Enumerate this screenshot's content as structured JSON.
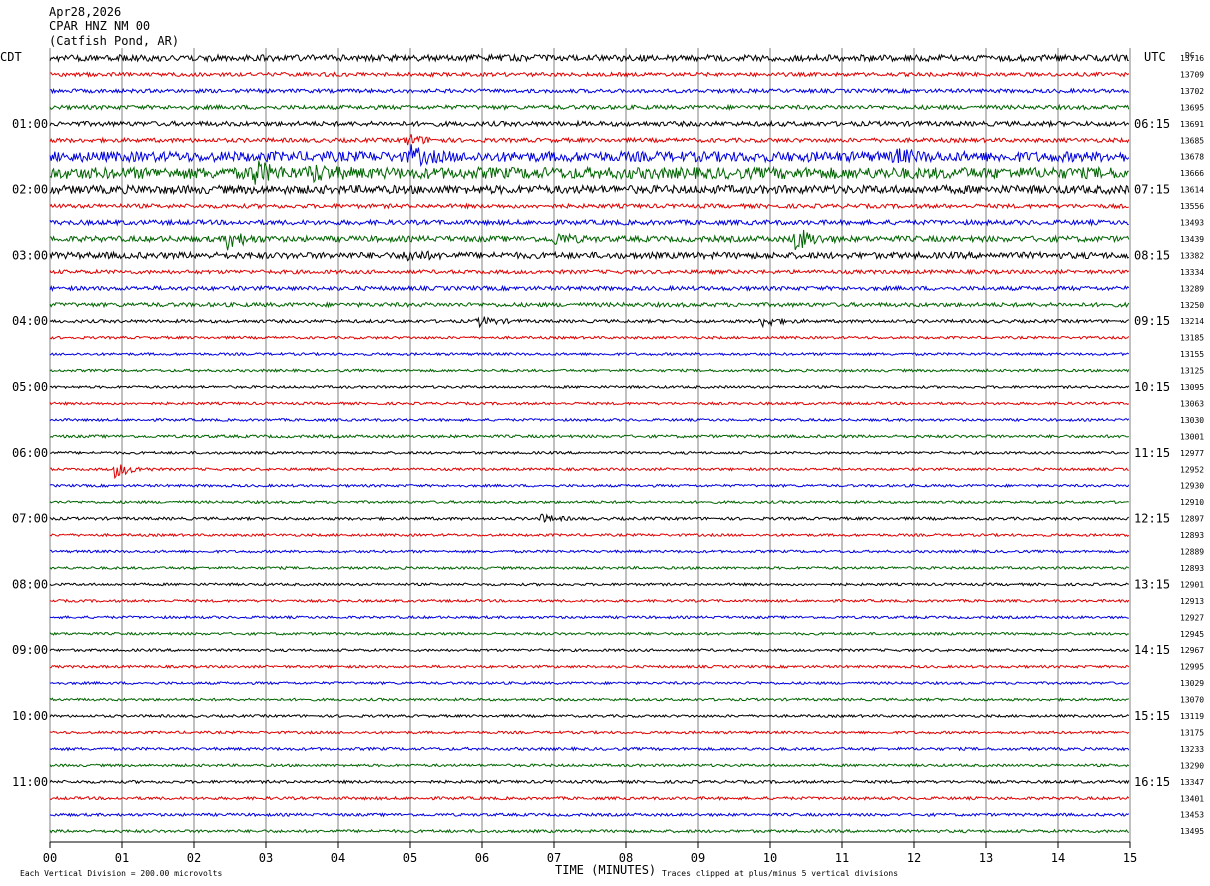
{
  "header": {
    "date": "Apr28,2026",
    "station": "CPAR HNZ NM 00",
    "location": "(Catfish Pond, AR)"
  },
  "left_axis_label": "CDT",
  "right_axis_label": "UTC",
  "dc_label": "DC",
  "footer": {
    "scale_note": "Each Vertical Division =  200.00 microvolts",
    "xlabel": "TIME (MINUTES)",
    "clip_note": "Traces clipped at plus/minus 5 vertical divisions"
  },
  "colors": {
    "trace_cycle": [
      "#000000",
      "#e00000",
      "#0000e0",
      "#006400"
    ],
    "grid": "#808080"
  },
  "chart_data": {
    "type": "line",
    "subtype": "helicorder",
    "xlim": [
      0,
      15
    ],
    "x_ticks": [
      "00",
      "01",
      "02",
      "03",
      "04",
      "05",
      "06",
      "07",
      "08",
      "09",
      "10",
      "11",
      "12",
      "13",
      "14",
      "15"
    ],
    "rows_per_hour": 4,
    "left_hour_labels": [
      "01:00",
      "02:00",
      "03:00",
      "04:00",
      "05:00",
      "06:00",
      "07:00",
      "08:00",
      "09:00",
      "10:00",
      "11:00"
    ],
    "right_hour_labels": [
      "06:15",
      "07:15",
      "08:15",
      "09:15",
      "10:15",
      "11:15",
      "12:15",
      "13:15",
      "14:15",
      "15:15",
      "16:15"
    ],
    "dc_values": [
      "13716",
      "13709",
      "13702",
      "13695",
      "13691",
      "13685",
      "13678",
      "13666",
      "13614",
      "13556",
      "13493",
      "13439",
      "13382",
      "13334",
      "13289",
      "13250",
      "13214",
      "13185",
      "13155",
      "13125",
      "13095",
      "13063",
      "13030",
      "13001",
      "12977",
      "12952",
      "12930",
      "12910",
      "12897",
      "12893",
      "12889",
      "12893",
      "12901",
      "12913",
      "12927",
      "12945",
      "12967",
      "12995",
      "13029",
      "13070",
      "13119",
      "13175",
      "13233",
      "13290",
      "13347",
      "13401",
      "13453",
      "13495"
    ],
    "row_activity": [
      2.0,
      1.2,
      1.2,
      1.3,
      1.5,
      1.3,
      3.2,
      3.6,
      2.6,
      1.3,
      1.5,
      1.8,
      2.0,
      1.2,
      1.3,
      1.3,
      1.0,
      0.8,
      0.8,
      0.8,
      0.8,
      0.8,
      0.8,
      0.9,
      0.8,
      0.8,
      0.8,
      0.8,
      0.9,
      0.8,
      0.8,
      0.8,
      0.8,
      0.8,
      0.8,
      0.8,
      0.8,
      0.8,
      0.8,
      0.8,
      0.8,
      0.8,
      0.9,
      0.8,
      0.9,
      0.9,
      0.9,
      0.9
    ],
    "events": [
      {
        "row": 5,
        "minute": 4.95,
        "amplitude": 6
      },
      {
        "row": 6,
        "minute": 5.0,
        "amplitude": 8
      },
      {
        "row": 6,
        "minute": 11.75,
        "amplitude": 5
      },
      {
        "row": 7,
        "minute": 2.8,
        "amplitude": 12
      },
      {
        "row": 7,
        "minute": 3.6,
        "amplitude": 8
      },
      {
        "row": 11,
        "minute": 2.45,
        "amplitude": 10
      },
      {
        "row": 11,
        "minute": 10.35,
        "amplitude": 12
      },
      {
        "row": 11,
        "minute": 7.0,
        "amplitude": 6
      },
      {
        "row": 12,
        "minute": 4.95,
        "amplitude": 5
      },
      {
        "row": 16,
        "minute": 5.95,
        "amplitude": 5
      },
      {
        "row": 16,
        "minute": 9.9,
        "amplitude": 5
      },
      {
        "row": 25,
        "minute": 0.9,
        "amplitude": 8
      },
      {
        "row": 28,
        "minute": 6.8,
        "amplitude": 4
      }
    ]
  }
}
